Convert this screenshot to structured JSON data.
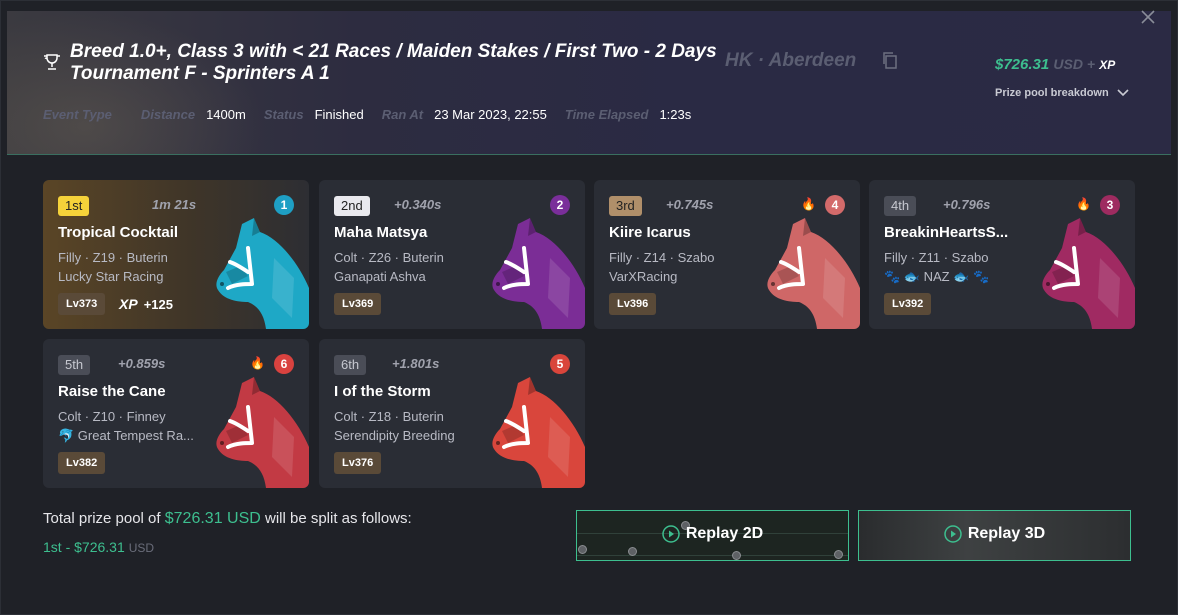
{
  "header": {
    "title": "Breed 1.0+, Class 3 with < 21 Races / Maiden Stakes / First Two - 2 Days Tournament F - Sprinters A 1",
    "location": "HK · Aberdeen",
    "prize_amount": "$726.31",
    "prize_currency": "USD +",
    "prize_xp": "XP",
    "breakdown_label": "Prize pool breakdown",
    "meta": {
      "event_type_label": "Event Type",
      "distance_label": "Distance",
      "distance": "1400m",
      "status_label": "Status",
      "status": "Finished",
      "ran_at_label": "Ran At",
      "ran_at": "23 Mar 2023, 22:55",
      "elapsed_label": "Time Elapsed",
      "elapsed": "1:23s"
    }
  },
  "results": [
    {
      "position": "1st",
      "gap": "1m 21s",
      "gate": "1",
      "name": "Tropical Cocktail",
      "info": "Filly · Z19 · Buterin",
      "owner": "Lucky Star Racing",
      "level": "Lv373",
      "xp_label": "XP",
      "xp_gain": "+125",
      "color": "#1ea8c6",
      "gate_color": "#1e9fc4",
      "pos_bg": "#f5d23a",
      "pos_fg": "#222",
      "flame": ""
    },
    {
      "position": "2nd",
      "gap": "+0.340s",
      "gate": "2",
      "name": "Maha Matsya",
      "info": "Colt · Z26 · Buterin",
      "owner": "Ganapati Ashva",
      "level": "Lv369",
      "color": "#7b2d96",
      "gate_color": "#7a2e9a",
      "pos_bg": "#e9e9ee",
      "pos_fg": "#222",
      "flame": ""
    },
    {
      "position": "3rd",
      "gap": "+0.745s",
      "gate": "4",
      "name": "Kiire Icarus",
      "info": "Filly · Z14 · Szabo",
      "owner": "VarXRacing",
      "level": "Lv396",
      "color": "#cf6767",
      "gate_color": "#d36a6a",
      "pos_bg": "#b08f6a",
      "pos_fg": "#222",
      "flame": "🔥"
    },
    {
      "position": "4th",
      "gap": "+0.796s",
      "gate": "3",
      "name": "BreakinHeartsS...",
      "info": "Filly · Z11 · Szabo",
      "owner": "🐾 🐟 NAZ 🐟 🐾",
      "level": "Lv392",
      "color": "#a02a62",
      "gate_color": "#9e2b60",
      "pos_bg": "#4a4d57",
      "pos_fg": "#c6c8d0",
      "flame": "🔥"
    },
    {
      "position": "5th",
      "gap": "+0.859s",
      "gate": "6",
      "name": "Raise the Cane",
      "info": "Colt · Z10 · Finney",
      "owner": "🐬 Great Tempest Ra...",
      "level": "Lv382",
      "color": "#c23a44",
      "gate_color": "#d9423f",
      "pos_bg": "#4a4d57",
      "pos_fg": "#c6c8d0",
      "flame": "🔥"
    },
    {
      "position": "6th",
      "gap": "+1.801s",
      "gate": "5",
      "name": "I of the Storm",
      "info": "Colt · Z18 · Buterin",
      "owner": "Serendipity Breeding",
      "level": "Lv376",
      "color": "#d9463c",
      "gate_color": "#d9453b",
      "pos_bg": "#4a4d57",
      "pos_fg": "#c6c8d0",
      "flame": ""
    }
  ],
  "prize_split": {
    "prefix": "Total prize pool of",
    "amount": "$726.31 USD",
    "suffix": "will be split as follows:",
    "first_place": "1st - $726.31",
    "first_place_currency": "USD"
  },
  "replay": {
    "replay_2d_label": "Replay 2D",
    "replay_3d_label": "Replay 3D"
  },
  "colors": {
    "accent_green": "#3dbf8f",
    "background": "#1f2127",
    "card": "#2a2d35"
  }
}
